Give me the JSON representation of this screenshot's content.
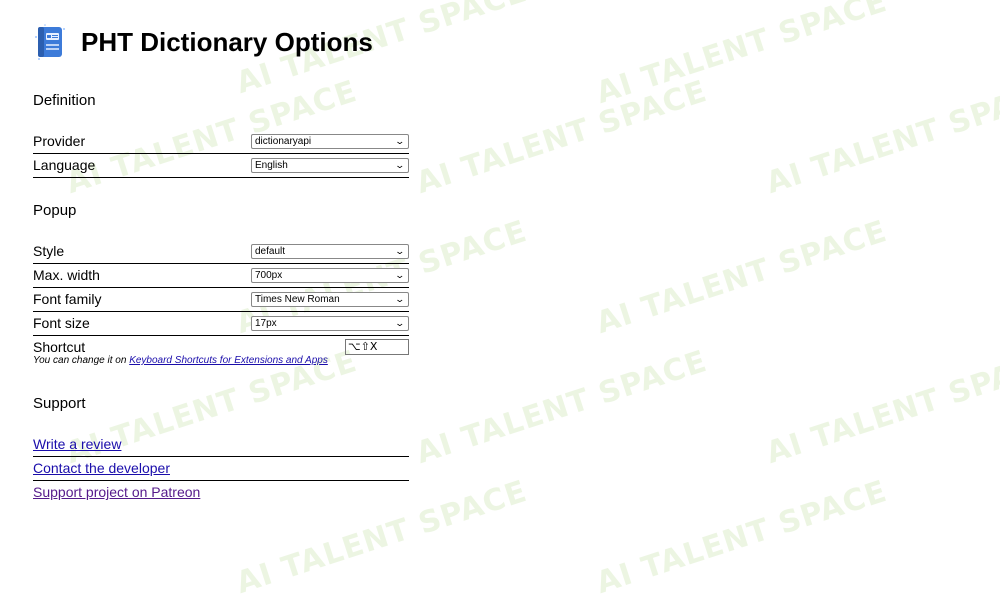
{
  "header": {
    "title": "PHT Dictionary Options",
    "icon": "dictionary-book-icon"
  },
  "watermark": {
    "text": "AI TALENT SPACE"
  },
  "definition": {
    "title": "Definition",
    "provider": {
      "label": "Provider",
      "value": "dictionaryapi"
    },
    "language": {
      "label": "Language",
      "value": "English"
    }
  },
  "popup": {
    "title": "Popup",
    "style": {
      "label": "Style",
      "value": "default"
    },
    "max_width": {
      "label": "Max. width",
      "value": "700px"
    },
    "font_family": {
      "label": "Font family",
      "value": "Times New Roman"
    },
    "font_size": {
      "label": "Font size",
      "value": "17px"
    },
    "shortcut": {
      "label": "Shortcut",
      "value": "⌥⇧X",
      "hint_prefix": "You can change it on ",
      "hint_link": "Keyboard Shortcuts for Extensions and Apps"
    }
  },
  "support": {
    "title": "Support",
    "links": [
      {
        "label": "Write a review"
      },
      {
        "label": "Contact the developer"
      },
      {
        "label": "Support project on Patreon"
      }
    ]
  },
  "colors": {
    "link": "#1a0dab",
    "visited_link": "#551a8b",
    "watermark": "#e6f2d9"
  }
}
